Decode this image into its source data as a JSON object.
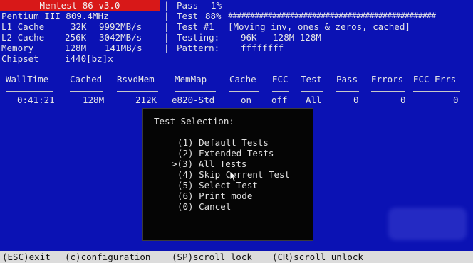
{
  "app": {
    "title": "Memtest-86 v3.0"
  },
  "system": {
    "cpu": "Pentium III 809.4MHz",
    "l1_label": "L1 Cache",
    "l1_size": "32K",
    "l1_speed": "9992MB/s",
    "l2_label": "L2 Cache",
    "l2_size": "256K",
    "l2_speed": "3042MB/s",
    "mem_label": "Memory",
    "mem_size": "128M",
    "mem_speed": "141MB/s",
    "chipset_label": "Chipset",
    "chipset_value": "i440[bz]x"
  },
  "progress": {
    "pass_label": "Pass",
    "pass_pct": "1%",
    "test_label": "Test",
    "test_pct": "88%",
    "test_bar": "###############################################",
    "test_num_label": "Test #1",
    "test_desc": "[Moving inv, ones & zeros, cached]",
    "testing_label": "Testing:",
    "testing_range": "96K - 128M 128M",
    "pattern_label": "Pattern:",
    "pattern_value": "ffffffff"
  },
  "table": {
    "headers": [
      "WallTime",
      "Cached",
      "RsvdMem",
      "MemMap",
      "Cache",
      "ECC",
      "Test",
      "Pass",
      "Errors",
      "ECC Errs"
    ],
    "values": [
      "0:41:21",
      "128M",
      "212K",
      "e820-Std",
      "on",
      "off",
      "All",
      "0",
      "0",
      "0"
    ]
  },
  "dialog": {
    "title": "Test Selection:",
    "items": [
      "(1) Default Tests",
      "(2) Extended Tests",
      ">(3) All Tests",
      "(4) Skip Current Test",
      "(5) Select Test",
      "(6) Print mode",
      "(0) Cancel"
    ]
  },
  "status_bar": {
    "esc": "(ESC)exit",
    "config": "(c)configuration",
    "scroll_lock": "(SP)scroll_lock",
    "scroll_unlock": "(CR)scroll_unlock"
  },
  "colors": {
    "background": "#0b12b4",
    "title_bar": "#d81818",
    "dialog": "#050505",
    "status_bar": "#dcdcdc"
  },
  "icons": {
    "cursor": "mouse-pointer-icon"
  }
}
